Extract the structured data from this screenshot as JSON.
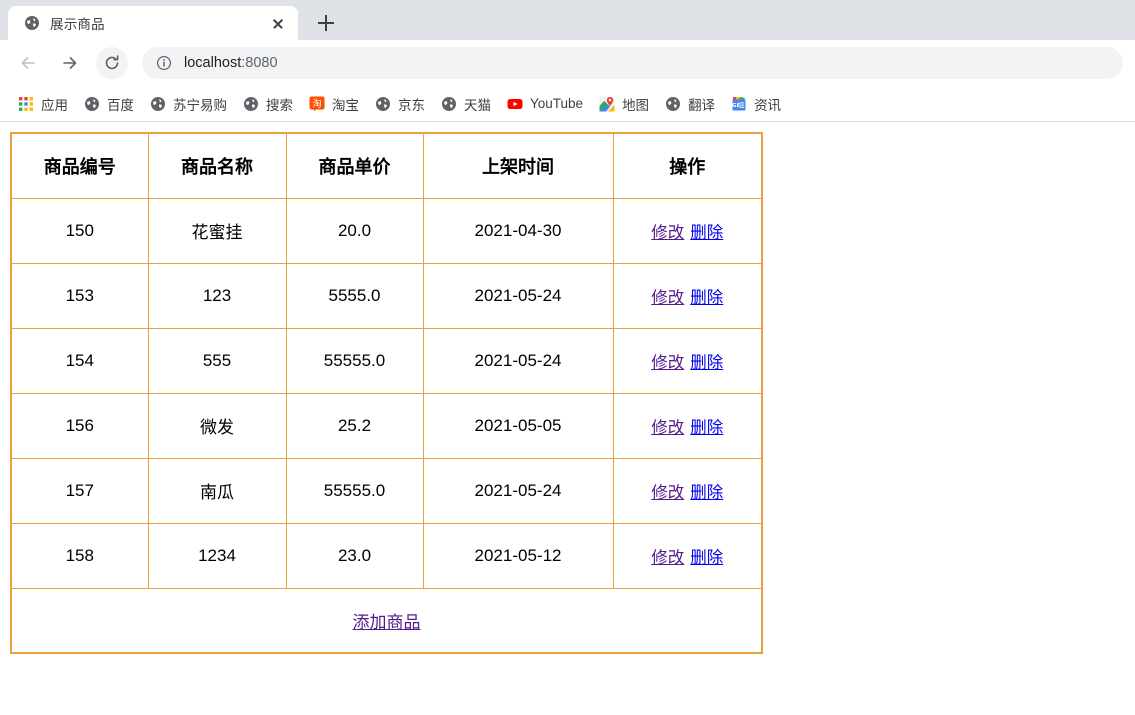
{
  "browser": {
    "tab": {
      "title": "展示商品",
      "favicon": "globe-icon",
      "close_label": "×"
    },
    "new_tab_label": "+",
    "nav": {
      "back_label": "←",
      "forward_label": "→",
      "reload_label": "⟳"
    },
    "omnibox": {
      "host": "localhost",
      "port": ":8080",
      "full_url": "localhost:8080",
      "security_icon": "info-circle-icon"
    },
    "bookmarks": [
      {
        "label": "应用",
        "icon": "apps-grid-icon"
      },
      {
        "label": "百度",
        "icon": "globe-icon"
      },
      {
        "label": "苏宁易购",
        "icon": "globe-icon"
      },
      {
        "label": "搜索",
        "icon": "globe-icon"
      },
      {
        "label": "淘宝",
        "icon": "taobao-icon"
      },
      {
        "label": "京东",
        "icon": "globe-icon"
      },
      {
        "label": "天猫",
        "icon": "globe-icon"
      },
      {
        "label": "YouTube",
        "icon": "youtube-icon"
      },
      {
        "label": "地图",
        "icon": "google-maps-icon"
      },
      {
        "label": "翻译",
        "icon": "globe-icon"
      },
      {
        "label": "资讯",
        "icon": "google-news-icon"
      }
    ]
  },
  "page": {
    "table": {
      "border_color": "#e8a33e",
      "headers": [
        "商品编号",
        "商品名称",
        "商品单价",
        "上架时间",
        "操作"
      ],
      "rows": [
        {
          "id": "150",
          "name": "花蜜挂",
          "price": "20.0",
          "date": "2021-04-30",
          "edit": "修改",
          "delete": "删除"
        },
        {
          "id": "153",
          "name": "123",
          "price": "5555.0",
          "date": "2021-05-24",
          "edit": "修改",
          "delete": "删除"
        },
        {
          "id": "154",
          "name": "555",
          "price": "55555.0",
          "date": "2021-05-24",
          "edit": "修改",
          "delete": "删除"
        },
        {
          "id": "156",
          "name": "微发",
          "price": "25.2",
          "date": "2021-05-05",
          "edit": "修改",
          "delete": "删除"
        },
        {
          "id": "157",
          "name": "南瓜",
          "price": "55555.0",
          "date": "2021-05-24",
          "edit": "修改",
          "delete": "删除"
        },
        {
          "id": "158",
          "name": "1234",
          "price": "23.0",
          "date": "2021-05-12",
          "edit": "修改",
          "delete": "删除"
        }
      ],
      "footer_link": "添加商品"
    }
  }
}
